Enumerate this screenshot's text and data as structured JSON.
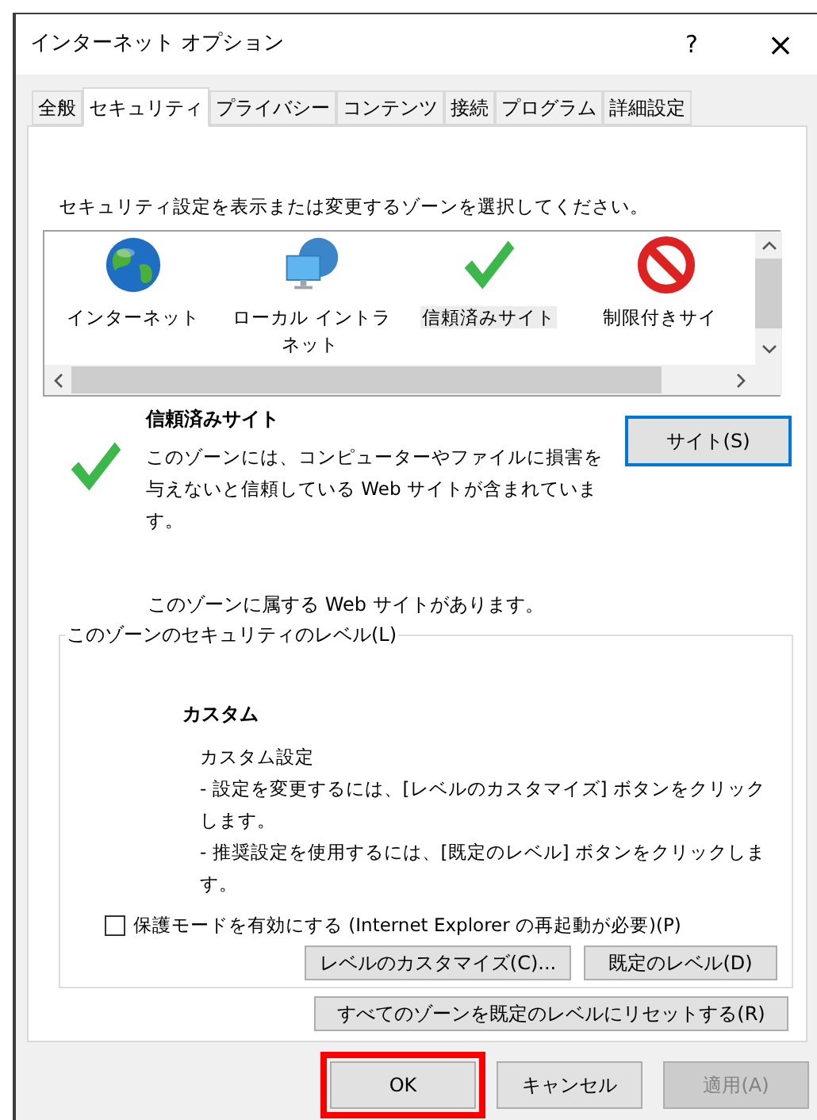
{
  "window": {
    "title": "インターネット オプション",
    "help": "?",
    "close": "×"
  },
  "tabs": [
    {
      "label": "全般",
      "selected": false
    },
    {
      "label": "セキュリティ",
      "selected": true
    },
    {
      "label": "プライバシー",
      "selected": false
    },
    {
      "label": "コンテンツ",
      "selected": false
    },
    {
      "label": "接続",
      "selected": false
    },
    {
      "label": "プログラム",
      "selected": false
    },
    {
      "label": "詳細設定",
      "selected": false
    }
  ],
  "instruction": "セキュリティ設定を表示または変更するゾーンを選択してください。",
  "zones": [
    {
      "kind": "globe",
      "label": "インターネット",
      "selected": false
    },
    {
      "kind": "intranet",
      "label": "ローカル イントラネット",
      "selected": false
    },
    {
      "kind": "check",
      "label": "信頼済みサイト",
      "selected": true
    },
    {
      "kind": "blocked",
      "label": "制限付きサイ",
      "selected": false
    }
  ],
  "zone_detail": {
    "kind": "check",
    "title": "信頼済みサイト",
    "description": "このゾーンには、コンピューターやファイルに損害を与えないと信頼している Web サイトが含まれています。",
    "sites_button": "サイト(S)"
  },
  "zone_note": "このゾーンに属する Web サイトがあります。",
  "security_level": {
    "legend": "このゾーンのセキュリティのレベル(L)",
    "level_name": "カスタム",
    "description_title": "カスタム設定",
    "lines": [
      "- 設定を変更するには、[レベルのカスタマイズ] ボタンをクリックします。",
      "- 推奨設定を使用するには、[既定のレベル] ボタンをクリックします。"
    ],
    "protected_mode": {
      "label": "保護モードを有効にする (Internet Explorer の再起動が必要)(P)",
      "checked": false
    },
    "buttons": [
      "レベルのカスタマイズ(C)...",
      "既定のレベル(D)"
    ]
  },
  "reset_button": "すべてのゾーンを既定のレベルにリセットする(R)",
  "dialog_buttons": [
    {
      "label": "OK",
      "highlighted": true,
      "disabled": false
    },
    {
      "label": "キャンセル",
      "highlighted": false,
      "disabled": false
    },
    {
      "label": "適用(A)",
      "highlighted": false,
      "disabled": true
    }
  ]
}
